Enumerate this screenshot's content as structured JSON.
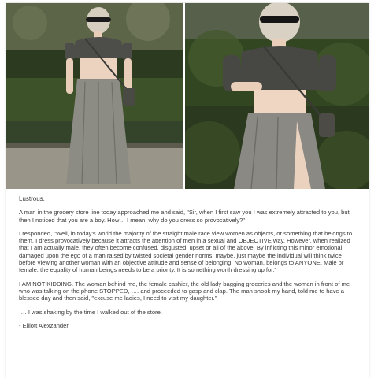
{
  "post": {
    "title": "Lustrous.",
    "paragraphs": [
      "A man in the grocery store line today approached me and said, \"Sir, when I first saw you I was extremely attracted to you, but then I noticed that you are a boy. How… I mean, why do you dress so provocatively?\"",
      "I responded, \"Well, in today's world the majority of the straight male race view women as objects, or something that belongs to them. I dress provocatively because it attracts the attention of men in a sexual and OBJECTIVE way. However, when realized that I am actually male, they often become confused, disgusted, upset or all of the above. By inflicting this minor emotional damaged upon the ego of a man raised by twisted societal gender norms, maybe, just maybe the individual will think twice before viewing another woman with an objective attitude and sense of belonging. No woman, belongs to ANYONE. Male or female, the equality of human beings needs to be a priority. It is something worth dressing up for.\"",
      "I AM NOT KIDDING. The woman behind me, the female cashier, the old lady bagging groceries and the woman in front of me who was talking on the phone STOPPED, …. and proceeded to gasp and clap. The man shook my hand, told me to have a blessed day and then said, \"excuse me ladies, I need to visit my daughter.\"",
      "…. I was shaking by the time I walked out of the store."
    ],
    "signature": "- Elliott Alexzander"
  },
  "photos": [
    {
      "subject": "full-length portrait in crop top and long grey skirt"
    },
    {
      "subject": "close portrait in crop top and long grey skirt"
    }
  ]
}
